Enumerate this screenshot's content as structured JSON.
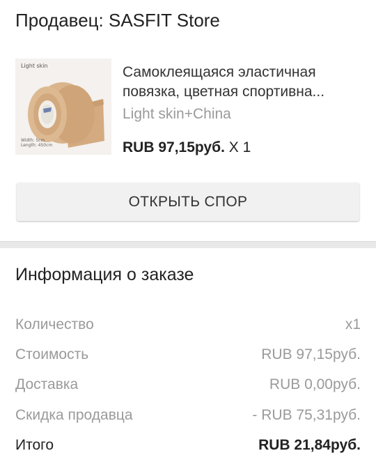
{
  "seller": {
    "label": "Продавец: SASFIT Store"
  },
  "product": {
    "image": {
      "caption": "Light skin",
      "width_text": "Width: 5cm",
      "length_text": "Length: 450cm"
    },
    "title_line1": "Самоклеящаяся эластичная",
    "title_line2": "повязка, цветная спортивна...",
    "variant": "Light skin+China",
    "price": "RUB 97,15руб.",
    "quantity": "X 1"
  },
  "dispute_button": {
    "label": "ОТКРЫТЬ СПОР"
  },
  "order_info": {
    "title": "Информация о заказе",
    "rows": [
      {
        "label": "Количество",
        "value": "x1"
      },
      {
        "label": "Стоимость",
        "value": "RUB 97,15руб."
      },
      {
        "label": "Доставка",
        "value": "RUB 0,00руб."
      },
      {
        "label": "Скидка продавца",
        "value": "- RUB 75,31руб."
      }
    ],
    "total": {
      "label": "Итого",
      "value": "RUB 21,84руб."
    }
  },
  "colors": {
    "text_primary": "#222222",
    "text_secondary": "#9a9a9a",
    "button_bg": "#f1f1f1",
    "divider_bg": "#e9e9e9",
    "bandage": "#d9b48c"
  }
}
